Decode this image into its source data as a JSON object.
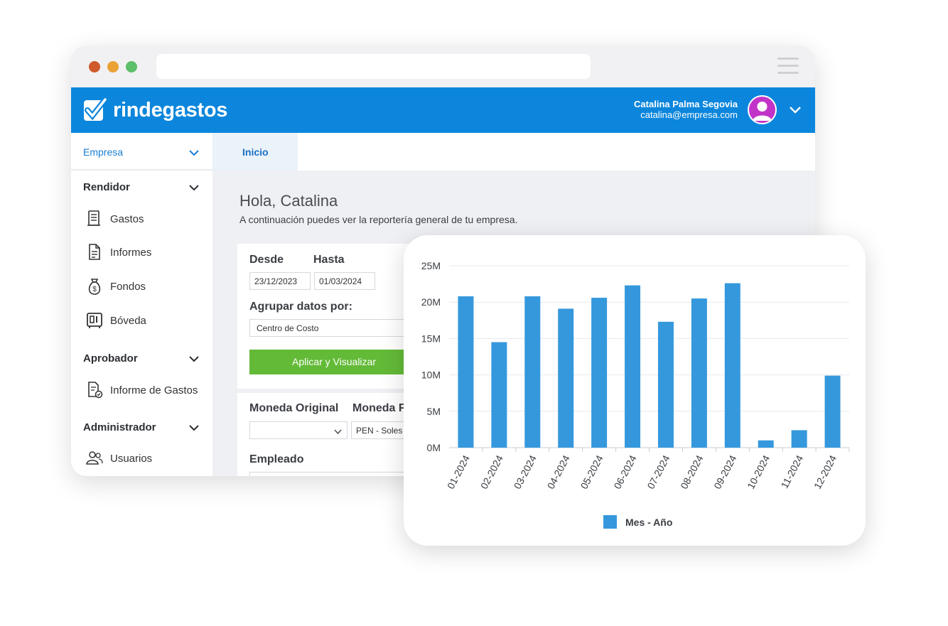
{
  "app": {
    "brand": "rindegastos",
    "user": {
      "name": "Catalina Palma Segovia",
      "email": "catalina@empresa.com"
    }
  },
  "sidebar": {
    "company": "Empresa",
    "sections": [
      {
        "title": "Rendidor",
        "items": [
          {
            "label": "Gastos",
            "icon": "receipt-icon"
          },
          {
            "label": "Informes",
            "icon": "document-icon"
          },
          {
            "label": "Fondos",
            "icon": "money-bag-icon"
          },
          {
            "label": "Bóveda",
            "icon": "vault-icon"
          }
        ]
      },
      {
        "title": "Aprobador",
        "items": [
          {
            "label": "Informe de Gastos",
            "icon": "report-check-icon"
          }
        ]
      },
      {
        "title": "Administrador",
        "items": [
          {
            "label": "Usuarios",
            "icon": "users-icon"
          }
        ]
      }
    ]
  },
  "tabs": [
    {
      "label": "Inicio",
      "active": true
    }
  ],
  "main": {
    "greeting": "Hola, Catalina",
    "subtitle": "A continuación puedes ver la reportería general de tu empresa.",
    "filters": {
      "desde_label": "Desde",
      "desde_value": "23/12/2023",
      "hasta_label": "Hasta",
      "hasta_value": "01/03/2024",
      "group_label": "Agrupar datos por:",
      "group_value": "Centro de Costo",
      "apply_label": "Aplicar y Visualizar",
      "moneda_original_label": "Moneda Original",
      "moneda_original_value": "",
      "moneda_final_label": "Moneda F",
      "moneda_final_value": "PEN - Soles",
      "empleado_label": "Empleado"
    }
  },
  "colors": {
    "header": "#0c86dc",
    "accent_text": "#1a7ed4",
    "apply_button": "#63ba37",
    "avatar": "#c233c8",
    "bars": "#3598dc"
  },
  "chart_data": {
    "type": "bar",
    "categories": [
      "01-2024",
      "02-2024",
      "03-2024",
      "04-2024",
      "05-2024",
      "06-2024",
      "07-2024",
      "08-2024",
      "09-2024",
      "10-2024",
      "11-2024",
      "12-2024"
    ],
    "series": [
      {
        "name": "Mes - Año",
        "values": [
          20.8,
          14.5,
          20.8,
          19.1,
          20.6,
          22.3,
          17.3,
          20.5,
          22.6,
          1.0,
          2.4,
          9.9
        ]
      }
    ],
    "value_unit": "M",
    "yticks": [
      "0M",
      "5M",
      "10M",
      "15M",
      "20M",
      "25M"
    ],
    "ylim": [
      0,
      25
    ],
    "grid": true,
    "legend": "bottom",
    "title": "",
    "xlabel": "",
    "ylabel": ""
  }
}
